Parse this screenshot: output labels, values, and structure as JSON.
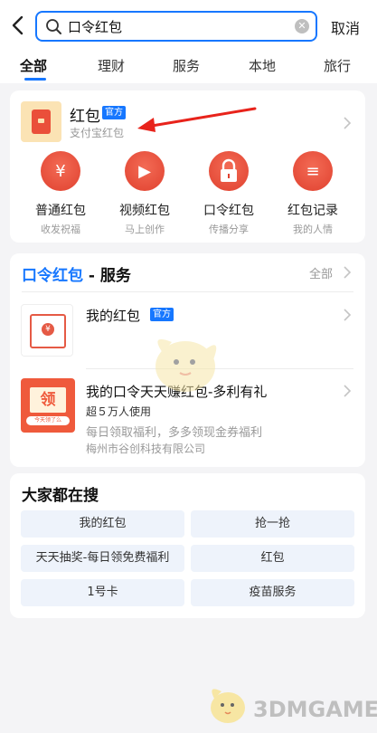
{
  "header": {
    "search_query": "口令红包",
    "cancel_label": "取消"
  },
  "tabs": [
    "全部",
    "理财",
    "服务",
    "本地",
    "旅行"
  ],
  "hongbao_card": {
    "title": "红包",
    "badge": "官方",
    "subtitle": "支付宝红包",
    "functions": [
      {
        "name": "普通红包",
        "desc": "收发祝福",
        "glyph": "¥",
        "icon": "yuan-icon"
      },
      {
        "name": "视频红包",
        "desc": "马上创作",
        "glyph": "▶",
        "icon": "video-icon"
      },
      {
        "name": "口令红包",
        "desc": "传播分享",
        "glyph": "🔒",
        "icon": "lock-icon"
      },
      {
        "name": "红包记录",
        "desc": "我的人情",
        "glyph": "≡",
        "icon": "record-icon"
      }
    ]
  },
  "services_section": {
    "title_highlight": "口令红包",
    "title_rest": " - 服务",
    "more_label": "全部",
    "items": [
      {
        "name": "我的红包",
        "badge": "官方",
        "icon_glyph": "¥"
      },
      {
        "name": "我的口令天天赚红包-多利有礼",
        "users": "超５万人使用",
        "desc": "每日领取福利，多多领现金券福利",
        "company": "梅州市谷创科技有限公司",
        "icon_glyph": "领",
        "icon_tag": "今天领了么"
      }
    ]
  },
  "popular": {
    "title": "大家都在搜",
    "chips": [
      "我的红包",
      "抢一抢",
      "天天抽奖-每日领免费福利",
      "红包",
      "1号卡",
      "疫苗服务"
    ]
  },
  "watermark": "3DMGAME",
  "colors": {
    "accent": "#1677ff",
    "red": "#e8412f",
    "chip_bg": "#eef3fb"
  }
}
